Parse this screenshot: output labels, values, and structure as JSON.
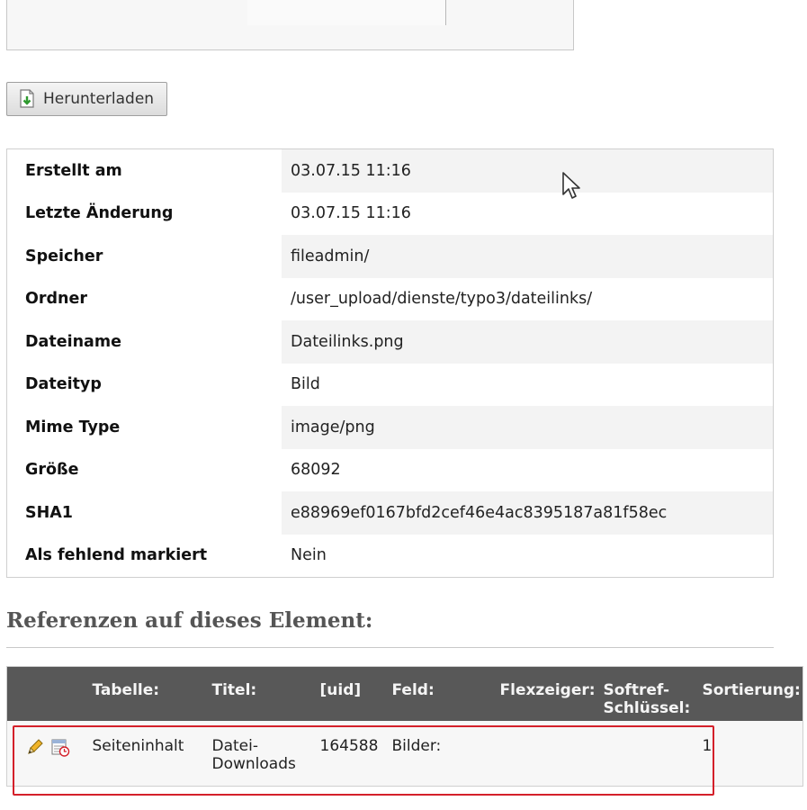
{
  "download_button": {
    "label": "Herunterladen",
    "icon": "download-file-icon"
  },
  "file_info": [
    {
      "label": "Erstellt am",
      "value": "03.07.15 11:16"
    },
    {
      "label": "Letzte Änderung",
      "value": "03.07.15 11:16"
    },
    {
      "label": "Speicher",
      "value": "fileadmin/"
    },
    {
      "label": "Ordner",
      "value": "/user_upload/dienste/typo3/dateilinks/"
    },
    {
      "label": "Dateiname",
      "value": "Dateilinks.png"
    },
    {
      "label": "Dateityp",
      "value": "Bild"
    },
    {
      "label": "Mime Type",
      "value": "image/png"
    },
    {
      "label": "Größe",
      "value": "68092"
    },
    {
      "label": "SHA1",
      "value": "e88969ef0167bfd2cef46e4ac8395187a81f58ec"
    },
    {
      "label": "Als fehlend markiert",
      "value": "Nein"
    }
  ],
  "references": {
    "heading": "Referenzen auf dieses Element:",
    "columns": [
      "Tabelle:",
      "Titel:",
      "[uid]",
      "Feld:",
      "Flexzeiger:",
      "Softref-Schlüssel:",
      "Sortierung:"
    ],
    "rows": [
      {
        "table": "Seiteninhalt",
        "title": "Datei-Downloads",
        "uid": "164588",
        "field": "Bilder:",
        "flexpointer": "",
        "softref_key": "",
        "sorting": "1"
      }
    ]
  },
  "colors": {
    "highlight": "#d4202a",
    "table_header": "#585858",
    "stripe": "#f3f3f3"
  }
}
